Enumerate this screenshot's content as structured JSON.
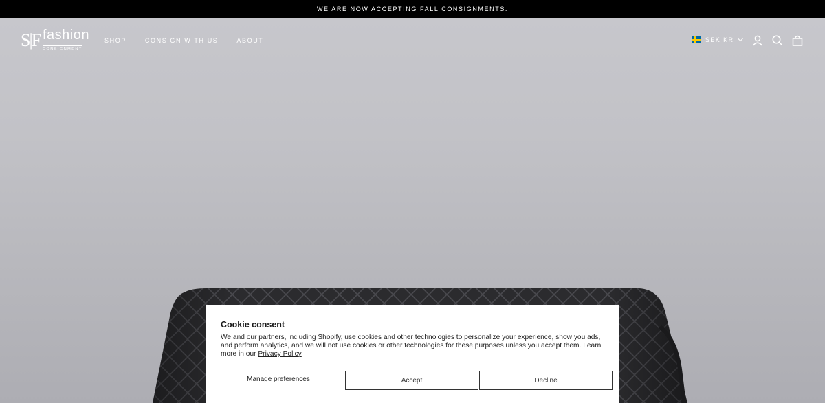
{
  "announcement": "WE ARE NOW ACCEPTING FALL CONSIGNMENTS.",
  "logo": {
    "mark": "S|F",
    "word": "fashion",
    "sub": "CONSIGNMENT"
  },
  "nav": [
    {
      "label": "SHOP"
    },
    {
      "label": "CONSIGN WITH US"
    },
    {
      "label": "ABOUT"
    }
  ],
  "currency": {
    "label": "SEK KR",
    "flag": "sweden-flag"
  },
  "header_icons": [
    "account-icon",
    "search-icon",
    "cart-icon"
  ],
  "cookie": {
    "title": "Cookie consent",
    "text": "We and our partners, including Shopify, use cookies and other technologies to personalize your experience, show you ads, and perform analytics, and we will not use cookies or other technologies for these purposes unless you accept them. Learn more in our",
    "privacy_link": "Privacy Policy",
    "manage_label": "Manage preferences",
    "accept_label": "Accept",
    "decline_label": "Decline"
  },
  "colors": {
    "announce_bg": "#000000",
    "hero_bg": "#c2c2c7",
    "bag": "#2a2a2c"
  }
}
